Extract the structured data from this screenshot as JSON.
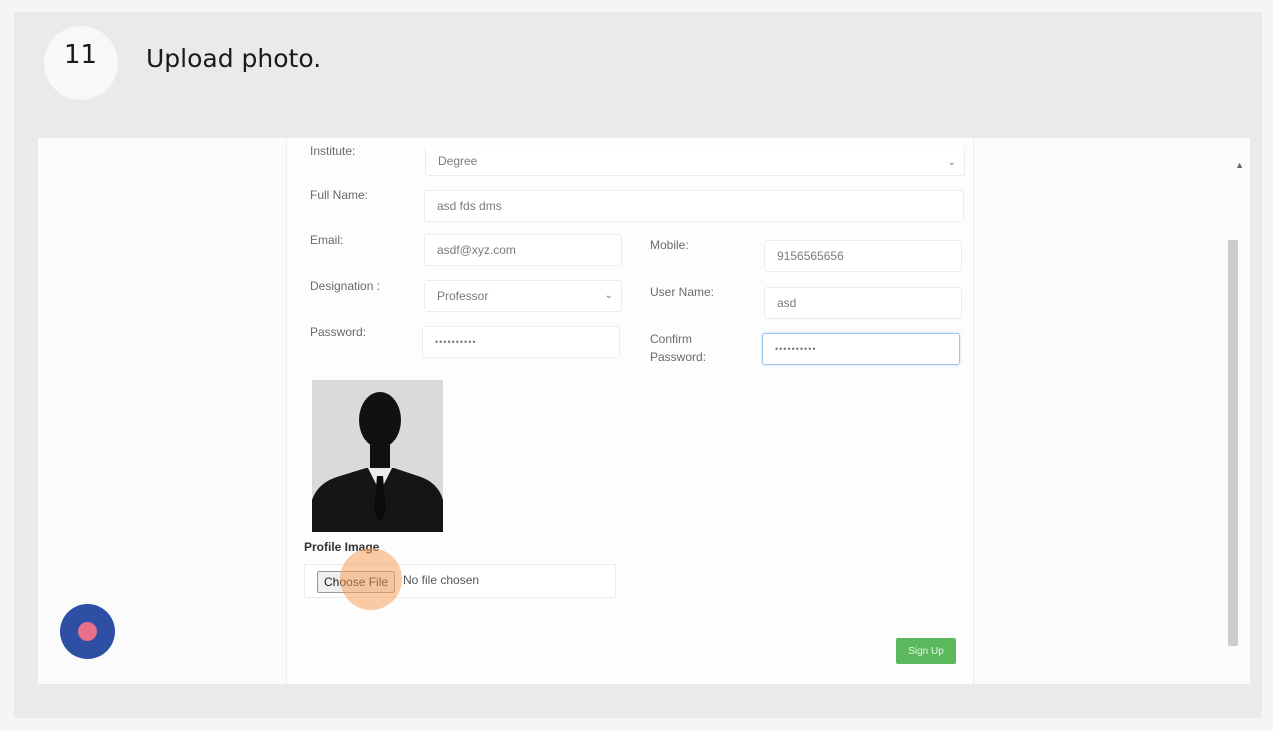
{
  "step": {
    "number": "11",
    "instruction": "Upload photo."
  },
  "form": {
    "institute": {
      "label": "Institute:",
      "value": "Degree"
    },
    "full_name": {
      "label": "Full Name:",
      "value": "asd fds dms"
    },
    "email": {
      "label": "Email:",
      "value": "asdf@xyz.com"
    },
    "mobile": {
      "label": "Mobile:",
      "value": "9156565656"
    },
    "designation": {
      "label": "Designation :",
      "value": "Professor"
    },
    "user_name": {
      "label": "User Name:",
      "value": "asd"
    },
    "password": {
      "label": "Password:",
      "value": "••••••••••"
    },
    "confirm_password": {
      "label_line1": "Confirm",
      "label_line2": "Password:",
      "value": "••••••••••"
    },
    "profile_image": {
      "label": "Profile Image",
      "choose_button": "Choose File",
      "status": "No file chosen"
    },
    "submit_label": "Sign Up"
  },
  "colors": {
    "submit_button": "#5cb85c",
    "click_highlight": "#f5a05a",
    "fab": "#2f4fa5",
    "fab_dot": "#e96f8a"
  },
  "icons": {
    "select_chevron": "chevron-down-icon",
    "scroll_up": "scroll-up-arrow-icon",
    "scroll_down": "scroll-down-arrow-icon",
    "avatar": "person-silhouette-icon"
  }
}
